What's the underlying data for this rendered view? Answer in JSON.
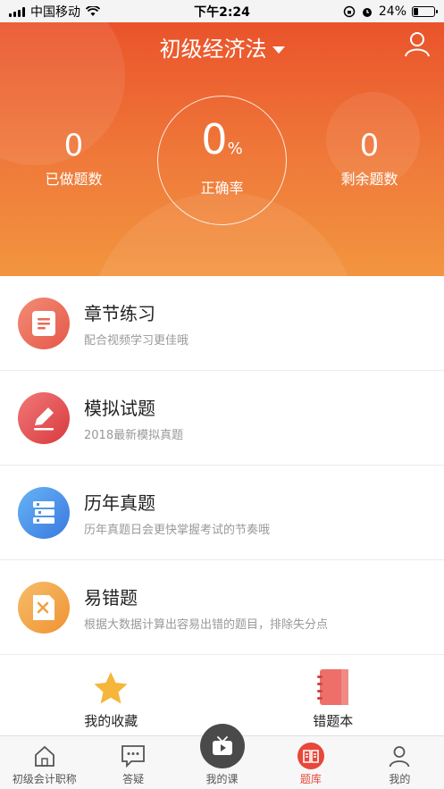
{
  "status": {
    "carrier": "中国移动",
    "time": "下午2:24",
    "battery": "24%",
    "battery_level": 0.24
  },
  "header": {
    "title": "初级经济法",
    "done": {
      "value": "0",
      "label": "已做题数"
    },
    "accuracy": {
      "value": "0",
      "unit": "%",
      "label": "正确率"
    },
    "remaining": {
      "value": "0",
      "label": "剩余题数"
    },
    "colors": {
      "top": "#ea532b",
      "bottom": "#f2953f"
    }
  },
  "items": [
    {
      "name": "章节练习",
      "desc": "配合视频学习更佳哦",
      "icon": "document-icon",
      "color": "#ea6a57"
    },
    {
      "name": "模拟试题",
      "desc": "2018最新模拟真题",
      "icon": "pencil-icon",
      "color": "#e54a4a"
    },
    {
      "name": "历年真题",
      "desc": "历年真题日会更快掌握考试的节奏哦",
      "icon": "books-icon",
      "color": "#4a90e8"
    },
    {
      "name": "易错题",
      "desc": "根据大数据计算出容易出错的题目，排除失分点",
      "icon": "error-note-icon",
      "color": "#f0a040"
    }
  ],
  "extras": [
    {
      "label": "我的收藏",
      "icon": "star-icon"
    },
    {
      "label": "错题本",
      "icon": "notebook-icon"
    }
  ],
  "tabs": [
    {
      "label": "初级会计职称",
      "icon": "home-icon"
    },
    {
      "label": "答疑",
      "icon": "chat-icon"
    },
    {
      "label": "我的课",
      "icon": "play-tv-icon"
    },
    {
      "label": "题库",
      "icon": "book-icon",
      "active": true
    },
    {
      "label": "我的",
      "icon": "person-icon"
    }
  ]
}
